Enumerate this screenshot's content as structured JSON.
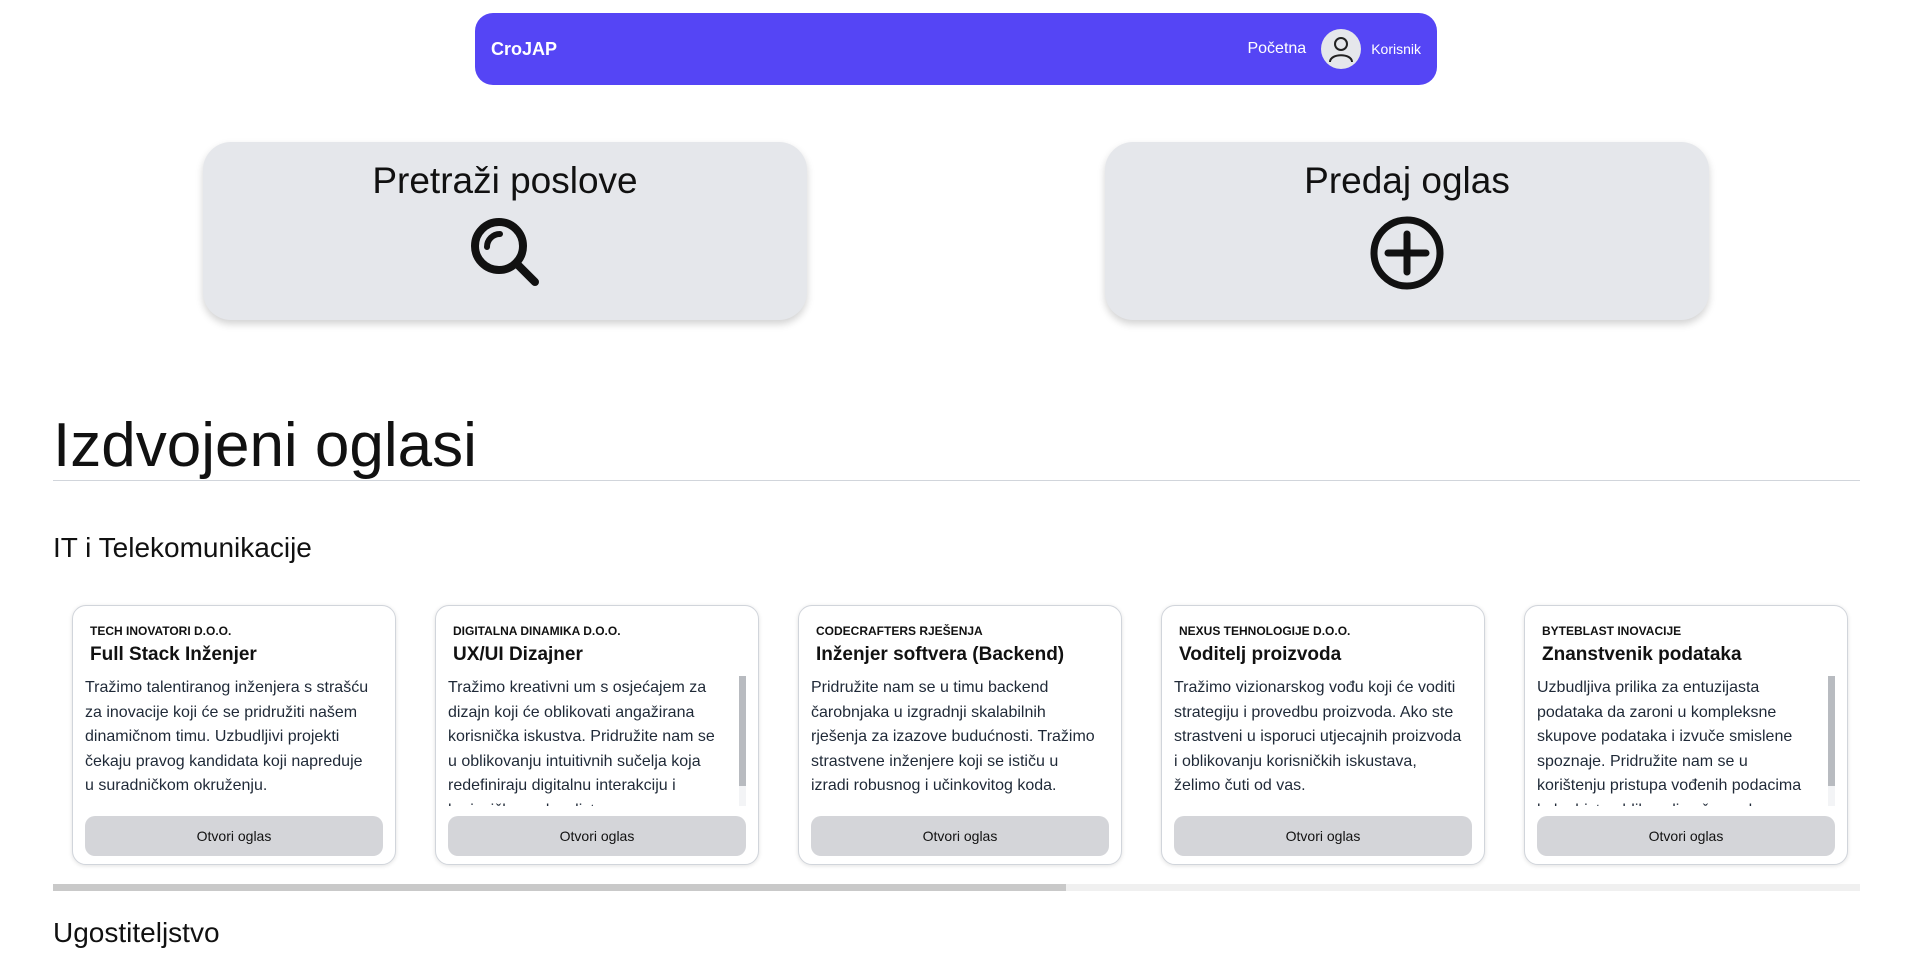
{
  "navbar": {
    "brand": "CroJAP",
    "home_link": "Početna",
    "user_label": "Korisnik",
    "accent_color": "#5545f5",
    "avatar_icon": "user-icon"
  },
  "actions": {
    "search": {
      "label": "Pretraži poslove",
      "icon": "search-icon"
    },
    "post": {
      "label": "Predaj oglas",
      "icon": "plus-circle-icon"
    }
  },
  "featured": {
    "title": "Izdvojeni oglasi",
    "categories": [
      {
        "name": "IT i Telekomunikacije",
        "jobs": [
          {
            "company": "Tech Inovatori d.o.o.",
            "title": "Full Stack Inženjer",
            "description": "Tražimo talentiranog inženjera s strašću za inovacije koji će se pridružiti našem dinamičnom timu. Uzbudljivi projekti čekaju pravog kandidata koji napreduje u suradničkom okruženju.",
            "button": "Otvori oglas"
          },
          {
            "company": "Digitalna Dinamika d.o.o.",
            "title": "UX/UI Dizajner",
            "description": "Tražimo kreativni um s osjećajem za dizajn koji će oblikovati angažirana korisnička iskustva. Pridružite nam se u oblikovanju intuitivnih sučelja koja redefiniraju digitalnu interakciju i korisničko zadovoljstvo.",
            "button": "Otvori oglas"
          },
          {
            "company": "CodeCrafters Rješenja",
            "title": "Inženjer softvera (Backend)",
            "description": "Pridružite nam se u timu backend čarobnjaka u izgradnji skalabilnih rješenja za izazove budućnosti. Tražimo strastvene inženjere koji se ističu u izradi robusnog i učinkovitog koda.",
            "button": "Otvori oglas"
          },
          {
            "company": "Nexus Tehnologije d.o.o.",
            "title": "Voditelj proizvoda",
            "description": "Tražimo vizionarskog vođu koji će voditi strategiju i provedbu proizvoda. Ako ste strastveni u isporuci utjecajnih proizvoda i oblikovanju korisničkih iskustava, želimo čuti od vas.",
            "button": "Otvori oglas"
          },
          {
            "company": "ByteBlast Inovacije",
            "title": "Znanstvenik podataka",
            "description": "Uzbudljiva prilika za entuzijasta podataka da zaroni u kompleksne skupove podataka i izvuče smislene spoznaje. Pridružite nam se u korištenju pristupa vođenih podacima kako biste oblikovali naše poslovne odluke.",
            "button": "Otvori oglas"
          }
        ]
      },
      {
        "name": "Ugostiteljstvo"
      }
    ]
  }
}
